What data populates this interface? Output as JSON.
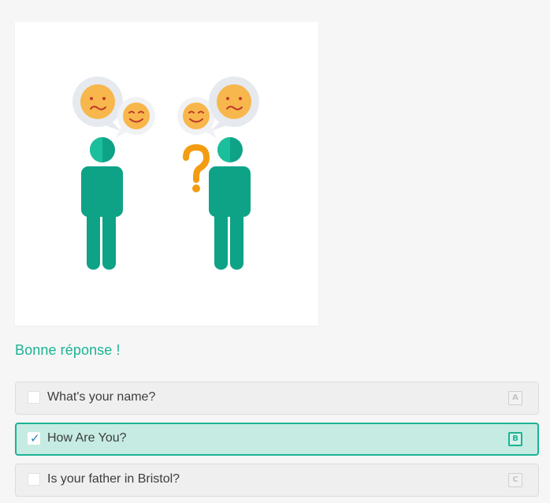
{
  "illustration": {
    "icon": "two-people-conversation-icon",
    "colors": {
      "person": "#0ea387",
      "person_light": "#1cbf9c",
      "emoji": "#f8b74c",
      "question_mark": "#f39c12",
      "bubble": "#e6e9ee"
    }
  },
  "feedback": {
    "text": "Bonne réponse !",
    "color": "#1bb394"
  },
  "options": [
    {
      "label": "What's your name?",
      "key": "A",
      "selected": false
    },
    {
      "label": "How Are You?",
      "key": "B",
      "selected": true
    },
    {
      "label": "Is your father in Bristol?",
      "key": "C",
      "selected": false
    }
  ],
  "checkmark": "✓"
}
